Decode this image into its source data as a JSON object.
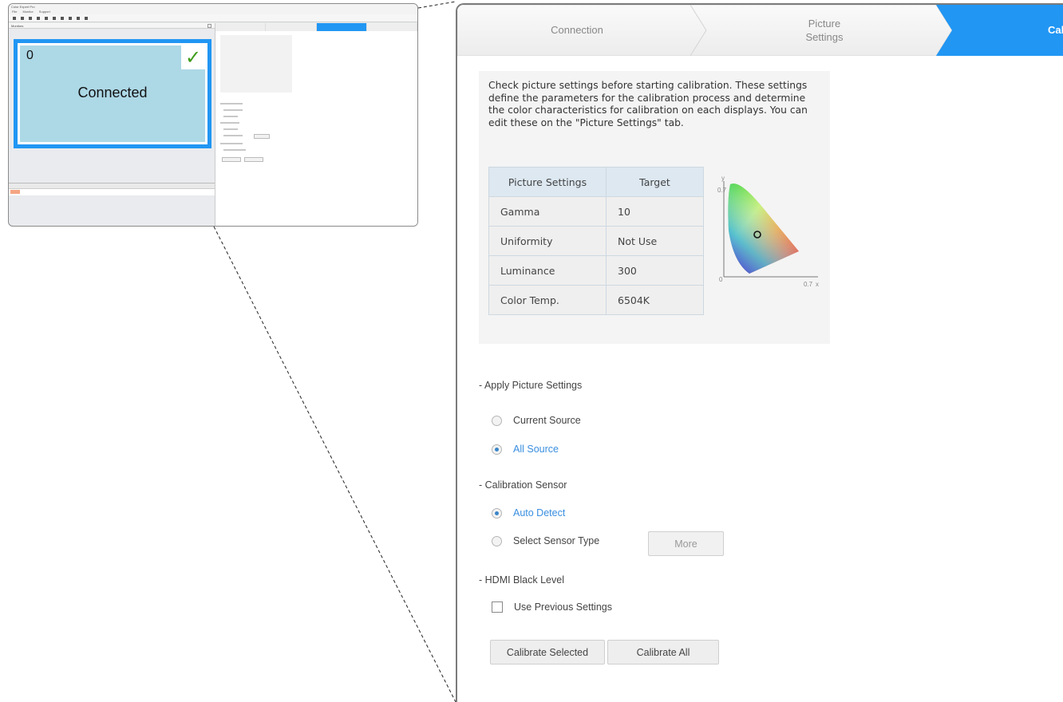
{
  "overview": {
    "app_title": "Color Expert Pro",
    "menu": [
      "File",
      "Monitor",
      "Support"
    ],
    "monitors_panel_title": "Monitors",
    "display": {
      "id": "0",
      "status": "Connected"
    }
  },
  "panel": {
    "tabs": [
      {
        "label": "Connection"
      },
      {
        "label": "Picture\nSettings"
      },
      {
        "label": "Cal"
      }
    ],
    "info_text": "Check picture settings before starting calibration. These settings define the parameters for the calibration process and determine the color characteristics for calibration on each displays. You can edit these on the \"Picture Settings\" tab.",
    "table": {
      "headers": [
        "Picture Settings",
        "Target"
      ],
      "rows": [
        [
          "Gamma",
          "10"
        ],
        [
          "Uniformity",
          "Not Use"
        ],
        [
          "Luminance",
          "300"
        ],
        [
          "Color Temp.",
          "6504K"
        ]
      ]
    },
    "gamut": {
      "y_axis": "y",
      "y_tick": "0.7",
      "x_axis": "x",
      "x_tick": "0.7",
      "origin": "0"
    },
    "apply_picture_settings": {
      "heading": "- Apply Picture Settings",
      "options": [
        "Current Source",
        "All Source"
      ],
      "selected": "All Source"
    },
    "calibration_sensor": {
      "heading": "- Calibration Sensor",
      "options": [
        "Auto Detect",
        "Select Sensor Type"
      ],
      "selected": "Auto Detect",
      "more_label": "More"
    },
    "hdmi_black_level": {
      "heading": "- HDMI Black Level",
      "checkbox_label": "Use Previous Settings",
      "checked": false
    },
    "buttons": {
      "calibrate_selected": "Calibrate Selected",
      "calibrate_all": "Calibrate All"
    }
  },
  "colors": {
    "accent": "#2196f3",
    "display_fill": "#add8e6",
    "check": "#3f9a1a",
    "selected_text": "#3a8fe0"
  }
}
